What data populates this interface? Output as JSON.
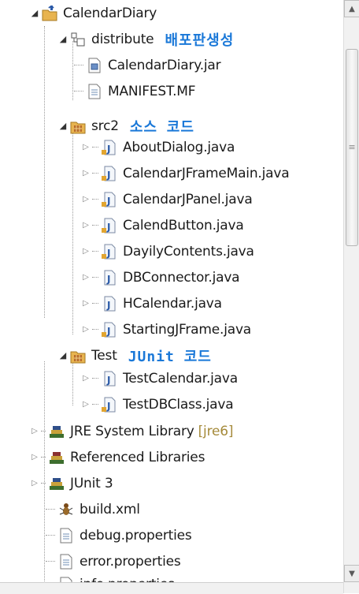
{
  "tree": {
    "root": {
      "label": "CalendarDiary",
      "icon": "java-project-icon"
    },
    "distribute": {
      "label": "distribute",
      "note": "배포판생성",
      "icon": "package-folder-icon"
    },
    "jar": {
      "label": "CalendarDiary.jar",
      "icon": "jar-file-icon"
    },
    "manifest": {
      "label": "MANIFEST.MF",
      "icon": "text-file-icon"
    },
    "src2": {
      "label": "src2",
      "note": "소스 코드",
      "icon": "source-folder-icon"
    },
    "src_files": [
      {
        "label": "AboutDialog.java"
      },
      {
        "label": "CalendarJFrameMain.java"
      },
      {
        "label": "CalendarJPanel.java"
      },
      {
        "label": "CalendButton.java"
      },
      {
        "label": "DayilyContents.java"
      },
      {
        "label": "DBConnector.java"
      },
      {
        "label": "HCalendar.java"
      },
      {
        "label": "StartingJFrame.java"
      }
    ],
    "test": {
      "label": "Test",
      "note": "JUnit 코드",
      "icon": "source-folder-icon"
    },
    "test_files": [
      {
        "label": "TestCalendar.java"
      },
      {
        "label": "TestDBClass.java"
      }
    ],
    "libraries": [
      {
        "label": "JRE System Library",
        "decoration": "[jre6]"
      },
      {
        "label": "Referenced Libraries",
        "decoration": ""
      },
      {
        "label": "JUnit 3",
        "decoration": ""
      }
    ],
    "root_files": [
      {
        "label": "build.xml",
        "icon": "ant-build-icon"
      },
      {
        "label": "debug.properties",
        "icon": "text-file-icon"
      },
      {
        "label": "error.properties",
        "icon": "text-file-icon"
      },
      {
        "label": "info.properties",
        "icon": "text-file-icon"
      }
    ]
  },
  "scrollbar": {
    "up": "▲",
    "down": "▼",
    "grip": "≡"
  },
  "colors": {
    "annotation": "#1a78d8",
    "java_icon": "#2b5aa8",
    "folder": "#d9a33a"
  }
}
